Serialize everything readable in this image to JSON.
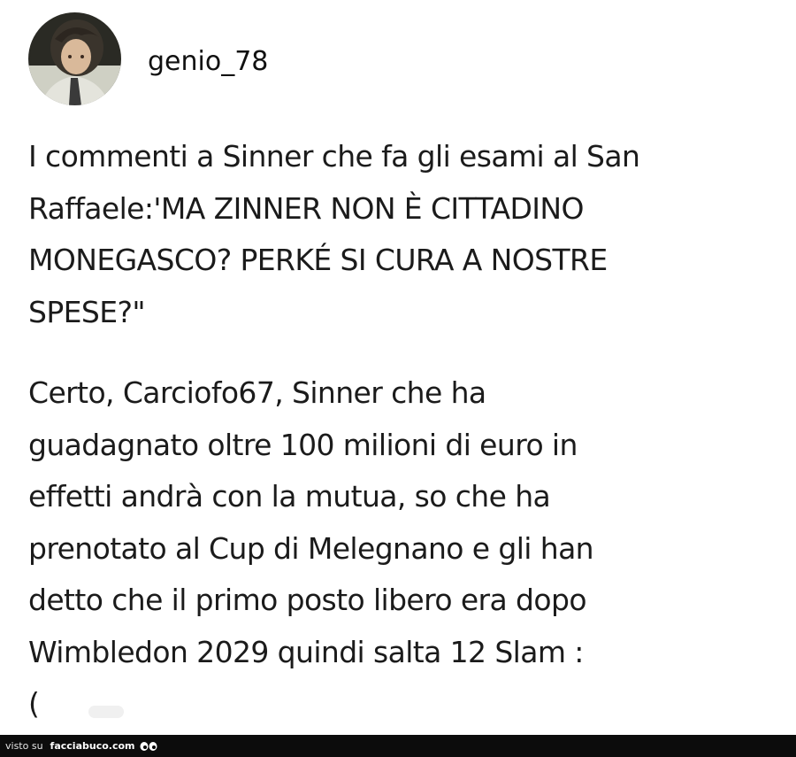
{
  "post": {
    "username": "genio_78",
    "paragraphs": [
      "I commenti a Sinner che fa gli esami al San\nRaffaele:'MA ZINNER NON È CITTADINO\nMONEGASCO? PERKÉ SI CURA A NOSTRE\nSPESE?\"",
      "Certo, Carciofo67, Sinner che ha\nguadagnato oltre 100 milioni di euro in\neffetti andrà con la mutua, so che ha\nprenotato al Cup di Melegnano e gli han\ndetto che il primo posto libero era dopo\nWimbledon 2029 quindi salta 12 Slam :\n("
    ]
  },
  "footer": {
    "prefix": "visto su",
    "site": "facciabuco.com",
    "logo_icon": "eyes-icon"
  }
}
